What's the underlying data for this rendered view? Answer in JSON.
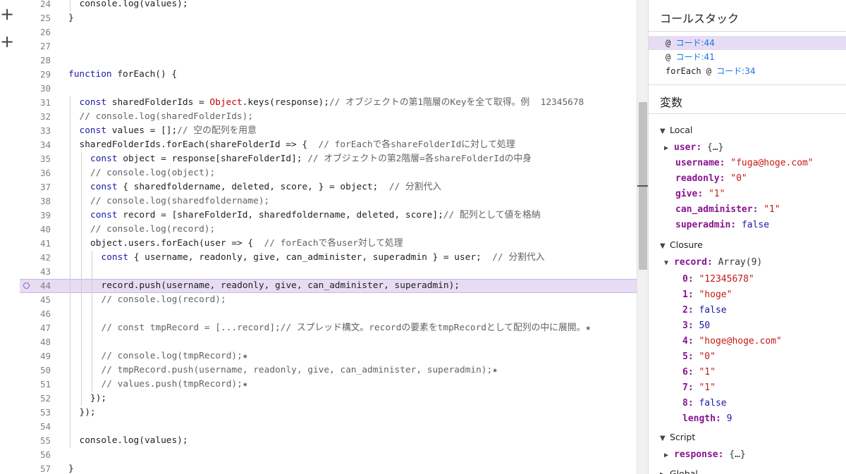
{
  "editor": {
    "lines": [
      {
        "n": "24",
        "indent": 1,
        "parts": [
          [
            "t",
            "console.log(values);"
          ]
        ]
      },
      {
        "n": "25",
        "indent": 0,
        "parts": [
          [
            "t",
            "}"
          ]
        ]
      },
      {
        "n": "26",
        "indent": 0,
        "parts": []
      },
      {
        "n": "27",
        "indent": 0,
        "parts": []
      },
      {
        "n": "28",
        "indent": 0,
        "parts": []
      },
      {
        "n": "29",
        "indent": 0,
        "parts": [
          [
            "kw",
            "function"
          ],
          [
            "t",
            " forEach() {"
          ]
        ]
      },
      {
        "n": "30",
        "indent": 0,
        "parts": []
      },
      {
        "n": "31",
        "indent": 1,
        "parts": [
          [
            "kw",
            "const"
          ],
          [
            "t",
            " sharedFolderIds = "
          ],
          [
            "obj",
            "Object"
          ],
          [
            "t",
            ".keys(response);"
          ],
          [
            "cm",
            "// オブジェクトの第1階層のKeyを全て取得。例  12345678"
          ]
        ]
      },
      {
        "n": "32",
        "indent": 1,
        "parts": [
          [
            "cm",
            "// console.log(sharedFolderIds);"
          ]
        ]
      },
      {
        "n": "33",
        "indent": 1,
        "parts": [
          [
            "kw",
            "const"
          ],
          [
            "t",
            " values = [];"
          ],
          [
            "cm",
            "// 空の配列を用意"
          ]
        ]
      },
      {
        "n": "34",
        "indent": 1,
        "parts": [
          [
            "t",
            "sharedFolderIds.forEach(shareFolderId => {  "
          ],
          [
            "cm",
            "// forEachで各shareFolderIdに対して処理"
          ]
        ]
      },
      {
        "n": "35",
        "indent": 2,
        "parts": [
          [
            "kw",
            "const"
          ],
          [
            "t",
            " object = response[shareFolderId]; "
          ],
          [
            "cm",
            "// オブジェクトの第2階層=各shareFolderIdの中身"
          ]
        ]
      },
      {
        "n": "36",
        "indent": 2,
        "parts": [
          [
            "cm",
            "// console.log(object);"
          ]
        ]
      },
      {
        "n": "37",
        "indent": 2,
        "parts": [
          [
            "kw",
            "const"
          ],
          [
            "t",
            " { sharedfoldername, deleted, score, } = object;  "
          ],
          [
            "cm",
            "// 分割代入"
          ]
        ]
      },
      {
        "n": "38",
        "indent": 2,
        "parts": [
          [
            "cm",
            "// console.log(sharedfoldername);"
          ]
        ]
      },
      {
        "n": "39",
        "indent": 2,
        "parts": [
          [
            "kw",
            "const"
          ],
          [
            "t",
            " record = [shareFolderId, sharedfoldername, deleted, score];"
          ],
          [
            "cm",
            "// 配列として値を格納"
          ]
        ]
      },
      {
        "n": "40",
        "indent": 2,
        "parts": [
          [
            "cm",
            "// console.log(record);"
          ]
        ]
      },
      {
        "n": "41",
        "indent": 2,
        "parts": [
          [
            "t",
            "object.users.forEach(user => {  "
          ],
          [
            "cm",
            "// forEachで各user対して処理"
          ]
        ]
      },
      {
        "n": "42",
        "indent": 3,
        "parts": [
          [
            "kw",
            "const"
          ],
          [
            "t",
            " { username, readonly, give, can_administer, superadmin } = user;  "
          ],
          [
            "cm",
            "// 分割代入"
          ]
        ]
      },
      {
        "n": "43",
        "indent": 3,
        "parts": []
      },
      {
        "n": "44",
        "indent": 3,
        "active": true,
        "parts": [
          [
            "t",
            "record.push(username, readonly, give, can_administer, superadmin);"
          ]
        ]
      },
      {
        "n": "45",
        "indent": 3,
        "parts": [
          [
            "cm",
            "// console.log(record);"
          ]
        ]
      },
      {
        "n": "46",
        "indent": 3,
        "parts": []
      },
      {
        "n": "47",
        "indent": 3,
        "parts": [
          [
            "cm",
            "// const tmpRecord = [...record];// スプレッド構文。recordの要素をtmpRecordとして配列の中に展開。★"
          ]
        ]
      },
      {
        "n": "48",
        "indent": 3,
        "parts": []
      },
      {
        "n": "49",
        "indent": 3,
        "parts": [
          [
            "cm",
            "// console.log(tmpRecord);★"
          ]
        ]
      },
      {
        "n": "50",
        "indent": 3,
        "parts": [
          [
            "cm",
            "// tmpRecord.push(username, readonly, give, can_administer, superadmin);★"
          ]
        ]
      },
      {
        "n": "51",
        "indent": 3,
        "parts": [
          [
            "cm",
            "// values.push(tmpRecord);★"
          ]
        ]
      },
      {
        "n": "52",
        "indent": 2,
        "parts": [
          [
            "t",
            "});"
          ]
        ]
      },
      {
        "n": "53",
        "indent": 1,
        "parts": [
          [
            "t",
            "});"
          ]
        ]
      },
      {
        "n": "54",
        "indent": 1,
        "parts": []
      },
      {
        "n": "55",
        "indent": 1,
        "parts": [
          [
            "t",
            "console.log(values);"
          ]
        ]
      },
      {
        "n": "56",
        "indent": 0,
        "parts": []
      },
      {
        "n": "57",
        "indent": 0,
        "parts": [
          [
            "t",
            "}"
          ]
        ]
      }
    ]
  },
  "callstack": {
    "title": "コールスタック",
    "frames": [
      {
        "fn": "@",
        "link": "コード:44",
        "active": true
      },
      {
        "fn": "@",
        "link": "コード:41",
        "active": false
      },
      {
        "fn": "forEach @",
        "link": "コード:34",
        "active": false
      }
    ]
  },
  "variables": {
    "title": "変数",
    "local_label": "Local",
    "closure_label": "Closure",
    "script_label": "Script",
    "global_label": "Global",
    "local": [
      {
        "k": "user",
        "v": "{…}",
        "type": "o",
        "expandable": true
      },
      {
        "k": "username",
        "v": "\"fuga@hoge.com\"",
        "type": "s"
      },
      {
        "k": "readonly",
        "v": "\"0\"",
        "type": "s"
      },
      {
        "k": "give",
        "v": "\"1\"",
        "type": "s"
      },
      {
        "k": "can_administer",
        "v": "\"1\"",
        "type": "s"
      },
      {
        "k": "superadmin",
        "v": "false",
        "type": "n"
      }
    ],
    "record_key": "record",
    "record_type": "Array(9)",
    "record": [
      {
        "k": "0",
        "v": "\"12345678\"",
        "type": "s"
      },
      {
        "k": "1",
        "v": "\"hoge\"",
        "type": "s"
      },
      {
        "k": "2",
        "v": "false",
        "type": "n"
      },
      {
        "k": "3",
        "v": "50",
        "type": "n"
      },
      {
        "k": "4",
        "v": "\"hoge@hoge.com\"",
        "type": "s"
      },
      {
        "k": "5",
        "v": "\"0\"",
        "type": "s"
      },
      {
        "k": "6",
        "v": "\"1\"",
        "type": "s"
      },
      {
        "k": "7",
        "v": "\"1\"",
        "type": "s"
      },
      {
        "k": "8",
        "v": "false",
        "type": "n"
      },
      {
        "k": "length",
        "v": "9",
        "type": "n"
      }
    ],
    "script": [
      {
        "k": "response",
        "v": "{…}",
        "type": "o",
        "expandable": true
      }
    ]
  },
  "colors": {
    "active_line": "#e6dcf3",
    "keyword": "#1a1aa6",
    "string": "#c41a16",
    "link": "#1a73e8"
  },
  "icons": {
    "add": "plus-icon",
    "expanded": "triangle-down-icon",
    "collapsed": "triangle-right-icon",
    "breakpoint": "breakpoint-circle-icon"
  }
}
